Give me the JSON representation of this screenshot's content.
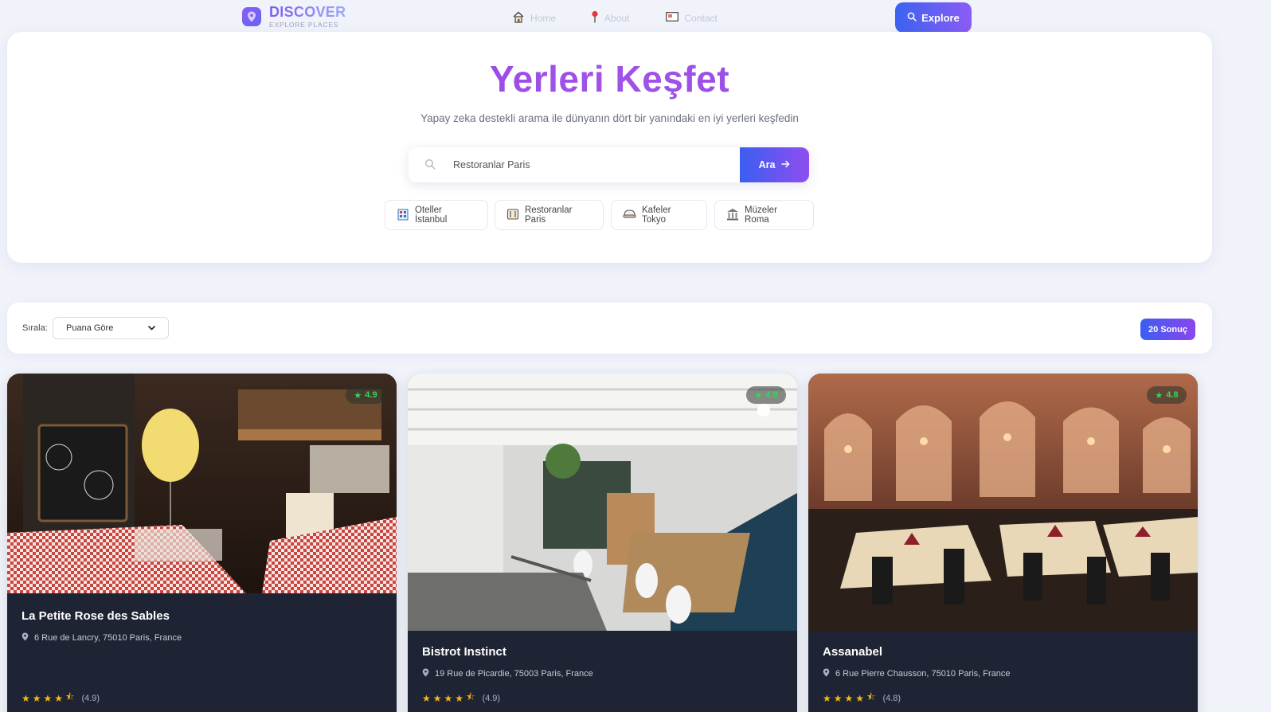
{
  "nav": {
    "logo_title": "DISCOVER",
    "logo_subtitle": "EXPLORE PLACES",
    "links": [
      {
        "label": "Home",
        "icon": "home-icon"
      },
      {
        "label": "About",
        "icon": "pin-icon"
      },
      {
        "label": "Contact",
        "icon": "mail-icon"
      }
    ],
    "explore_label": "Explore"
  },
  "hero": {
    "title": "Yerleri Keşfet",
    "subtitle": "Yapay zeka destekli arama ile dünyanın dört bir yanındaki en iyi yerleri keşfedin",
    "search_value": "Restoranlar Paris",
    "search_button": "Ara",
    "chips": [
      {
        "label": "Oteller İstanbul",
        "icon": "hotel-icon"
      },
      {
        "label": "Restoranlar Paris",
        "icon": "restaurant-icon"
      },
      {
        "label": "Kafeler Tokyo",
        "icon": "cafe-icon"
      },
      {
        "label": "Müzeler Roma",
        "icon": "museum-icon"
      }
    ]
  },
  "sort": {
    "label": "Sırala:",
    "selected": "Puana Göre",
    "results": "20 Sonuç"
  },
  "cards": [
    {
      "name": "La Petite Rose des Sables",
      "address": "6 Rue de Lancry, 75010 Paris, France",
      "rating": "4.9",
      "score_text": "(4.9)",
      "stars": 4.5
    },
    {
      "name": "Bistrot Instinct",
      "address": "19 Rue de Picardie, 75003 Paris, France",
      "rating": "4.9",
      "score_text": "(4.9)",
      "stars": 4.5
    },
    {
      "name": "Assanabel",
      "address": "6 Rue Pierre Chausson, 75010 Paris, France",
      "rating": "4.8",
      "score_text": "(4.8)",
      "stars": 4.5
    }
  ],
  "colors": {
    "accent_start": "#3b5ef0",
    "accent_end": "#8b46ee",
    "title_purple": "#8b39e0",
    "rating_green": "#39d264",
    "star_gold": "#f5b81c",
    "card_dark": "#1e2433"
  }
}
